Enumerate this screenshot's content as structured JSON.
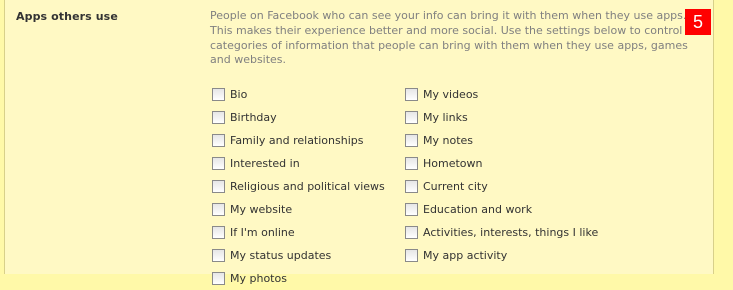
{
  "section": {
    "title": "Apps others use",
    "description": "People on Facebook who can see your info can bring it with them when they use apps. This makes their experience better and more social. Use the settings below to control the categories of information that people can bring with them when they use apps, games and websites.",
    "badge": "5"
  },
  "options": {
    "left": [
      {
        "label": "Bio",
        "checked": false
      },
      {
        "label": "Birthday",
        "checked": false
      },
      {
        "label": "Family and relationships",
        "checked": false
      },
      {
        "label": "Interested in",
        "checked": false
      },
      {
        "label": "Religious and political views",
        "checked": false
      },
      {
        "label": "My website",
        "checked": false
      },
      {
        "label": "If I'm online",
        "checked": false
      },
      {
        "label": "My status updates",
        "checked": false
      },
      {
        "label": "My photos",
        "checked": false
      }
    ],
    "right": [
      {
        "label": "My videos",
        "checked": false
      },
      {
        "label": "My links",
        "checked": false
      },
      {
        "label": "My notes",
        "checked": false
      },
      {
        "label": "Hometown",
        "checked": false
      },
      {
        "label": "Current city",
        "checked": false
      },
      {
        "label": "Education and work",
        "checked": false
      },
      {
        "label": "Activities, interests, things I like",
        "checked": false
      },
      {
        "label": "My app activity",
        "checked": false
      }
    ]
  },
  "colors": {
    "page_background": "#fff9a8",
    "panel_background": "#fff9c4",
    "badge_background": "#ff0000"
  }
}
